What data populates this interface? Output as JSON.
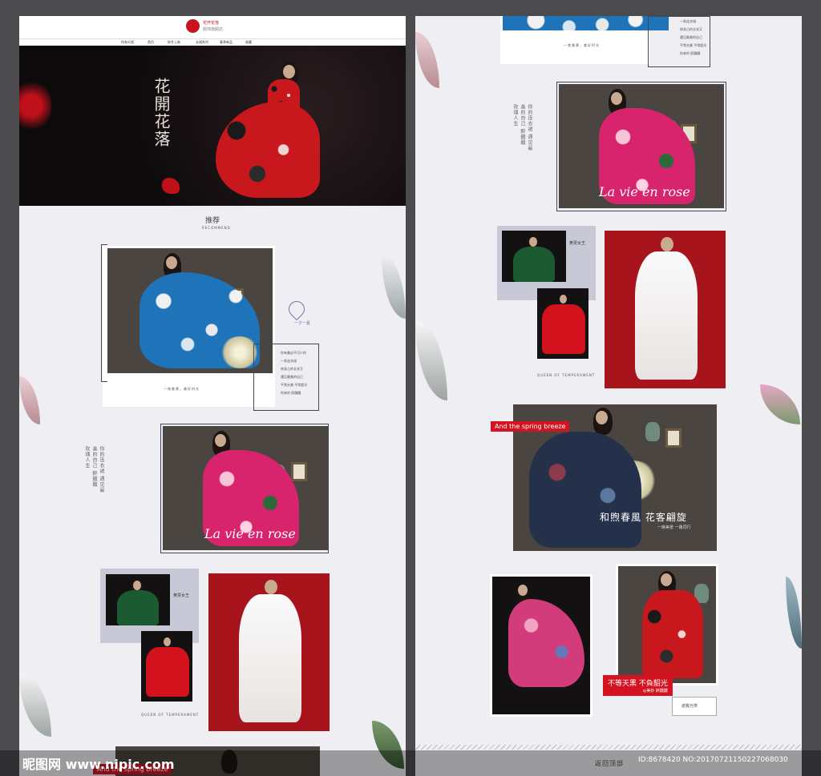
{
  "header": {
    "brand_line1": "花开花落",
    "brand_line2": "服饰旗舰店",
    "nav": [
      "所有分类",
      "首页",
      "秋冬上新",
      "长裙系列",
      "春季新品",
      "收藏"
    ]
  },
  "hero": {
    "title": "花開花落"
  },
  "left": {
    "recommend_label": "推荐",
    "recommend_sub": "RECOMMEND",
    "xia_label": "一夕一夏",
    "poem_lines": [
      "你有最必不可少的",
      "一条连衣裙",
      "修身凸的长衣又",
      "遇见最美的自己",
      "平常夫美 平常超光",
      "你来的 醉醺醺"
    ],
    "caption_box1": "一席美景，美好时光",
    "script1": "La vie en rose",
    "queen_label": "黄贾女王",
    "queen_en": "QUEEN OF TEMPERAMENT",
    "vertical_text": "你的连衣裙 遇见最美的自己 醉醺醺 玫瑰人生",
    "spring_label": "And the spring breeze"
  },
  "right": {
    "poem_lines": [
      "一条连衣裙",
      "修身凸的长衣又",
      "遇见最美的自己",
      "平常夫美 平常超光",
      "你来的 醉醺醺"
    ],
    "caption_top": "一席美景，美好时光",
    "script1": "La vie en rose",
    "queen_label": "黄贾女王",
    "queen_en": "QUEEN OF TEMPERAMENT",
    "spring_label": "And the spring breeze",
    "spring_title": "和煦春風 花客翩旋",
    "spring_sub": "一席美景 一路同行",
    "red_slogan": "不等天黑 不負韶光",
    "red_slogan_sub": "◎美妙 醉醺醺",
    "small_box": "遮翼光帶",
    "back_top": "返回顶部"
  },
  "watermark": {
    "site": "昵图网 www.nipic.com",
    "id": "ID:8678420 NO:20170721150227068030"
  },
  "colors": {
    "accent_red": "#d41322",
    "panel_bg": "#eeeef3",
    "outline": "#44465e"
  }
}
